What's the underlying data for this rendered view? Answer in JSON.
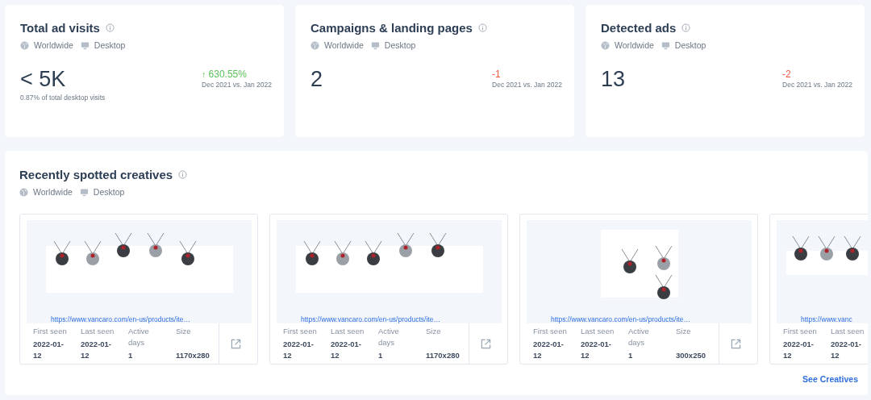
{
  "metrics": [
    {
      "title": "Total ad visits",
      "region": "Worldwide",
      "device": "Desktop",
      "value": "< 5K",
      "note": "0.87% of total desktop visits",
      "arrow": "↑",
      "change": "630.55%",
      "color": "#5cc05c",
      "period": "Dec 2021 vs. Jan 2022"
    },
    {
      "title": "Campaigns & landing pages",
      "region": "Worldwide",
      "device": "Desktop",
      "value": "2",
      "change": "-1",
      "color": "#f2553f",
      "period": "Dec 2021 vs. Jan 2022"
    },
    {
      "title": "Detected ads",
      "region": "Worldwide",
      "device": "Desktop",
      "value": "13",
      "change": "-2",
      "color": "#f2553f",
      "period": "Dec 2021 vs. Jan 2022"
    }
  ],
  "creatives_panel": {
    "title": "Recently spotted creatives",
    "region": "Worldwide",
    "device": "Desktop",
    "link": "See Creatives",
    "creatives": [
      {
        "url": "https://www.vancaro.com/en-us/products/ite…",
        "meta": [
          {
            "label": "First seen",
            "value": "2022-01-12"
          },
          {
            "label": "Last seen",
            "value": "2022-01-12"
          },
          {
            "label": "Active days",
            "value": "1"
          },
          {
            "label": "Size",
            "value": "1170x280"
          }
        ],
        "open_link": true
      },
      {
        "url": "https://www.vancaro.com/en-us/products/ite…",
        "meta": [
          {
            "label": "First seen",
            "value": "2022-01-12"
          },
          {
            "label": "Last seen",
            "value": "2022-01-12"
          },
          {
            "label": "Active days",
            "value": "1"
          },
          {
            "label": "Size",
            "value": "1170x280"
          }
        ],
        "open_link": true
      },
      {
        "url": "https://www.vancaro.com/en-us/products/ite…",
        "meta": [
          {
            "label": "First seen",
            "value": "2022-01-12"
          },
          {
            "label": "Last seen",
            "value": "2022-01-12"
          },
          {
            "label": "Active days",
            "value": "1"
          },
          {
            "label": "Size",
            "value": "300x250"
          }
        ],
        "open_link": true
      },
      {
        "url": "https://www.vanc",
        "meta": [
          {
            "label": "First seen",
            "value": "2022-01-12"
          },
          {
            "label": "Last seen",
            "value": "2022-01-12"
          }
        ]
      }
    ]
  }
}
